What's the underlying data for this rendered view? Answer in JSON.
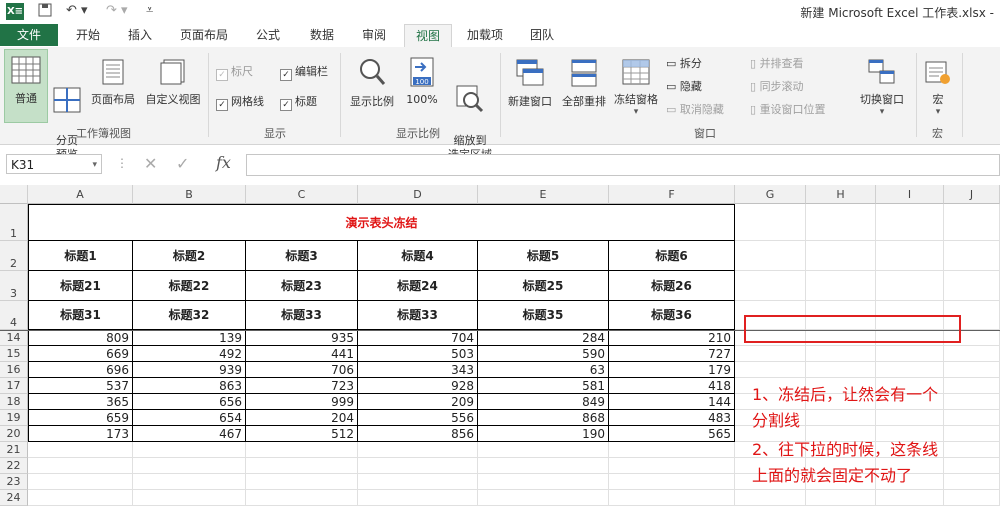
{
  "title_bar": {
    "app_logo": "X≡",
    "window_title": "新建 Microsoft Excel 工作表.xlsx -"
  },
  "tabs": [
    "文件",
    "开始",
    "插入",
    "页面布局",
    "公式",
    "数据",
    "审阅",
    "视图",
    "加载项",
    "团队"
  ],
  "active_tab": "视图",
  "ribbon": {
    "workbook_views": {
      "label": "工作簿视图",
      "normal": "普通",
      "page_break": "分页\n预览",
      "page_layout": "页面布局",
      "custom_view": "自定义视图"
    },
    "show": {
      "label": "显示",
      "ruler": "标尺",
      "formula_bar": "编辑栏",
      "gridlines": "网格线",
      "headings": "标题"
    },
    "zoom": {
      "label": "显示比例",
      "zoom": "显示比例",
      "zoom100": "100%",
      "zoom_selection": "缩放到\n选定区域",
      "icon_100": "100"
    },
    "window": {
      "label": "窗口",
      "new_window": "新建窗口",
      "arrange_all": "全部重排",
      "freeze_panes": "冻结窗格",
      "split": "拆分",
      "hide": "隐藏",
      "unhide": "取消隐藏",
      "side_by_side": "并排查看",
      "sync_scroll": "同步滚动",
      "reset_position": "重设窗口位置",
      "switch_windows": "切换窗口"
    },
    "macros": {
      "label": "宏",
      "macros": "宏"
    }
  },
  "formula_bar": {
    "name_box": "K31",
    "fx": "fx",
    "value": ""
  },
  "columns": [
    "A",
    "B",
    "C",
    "D",
    "E",
    "F",
    "G",
    "H",
    "I",
    "J"
  ],
  "rows": [
    "1",
    "2",
    "3",
    "4",
    "14",
    "15",
    "16",
    "17",
    "18",
    "19",
    "20",
    "21",
    "22",
    "23",
    "24"
  ],
  "sheet": {
    "title": "演示表头冻结",
    "header_rows": [
      [
        "标题1",
        "标题2",
        "标题3",
        "标题4",
        "标题5",
        "标题6"
      ],
      [
        "标题21",
        "标题22",
        "标题23",
        "标题24",
        "标题25",
        "标题26"
      ],
      [
        "标题31",
        "标题32",
        "标题33",
        "标题33",
        "标题35",
        "标题36"
      ]
    ],
    "data_rows": [
      [
        "809",
        "139",
        "935",
        "704",
        "284",
        "210"
      ],
      [
        "669",
        "492",
        "441",
        "503",
        "590",
        "727"
      ],
      [
        "696",
        "939",
        "706",
        "343",
        "63",
        "179"
      ],
      [
        "537",
        "863",
        "723",
        "928",
        "581",
        "418"
      ],
      [
        "365",
        "656",
        "999",
        "209",
        "849",
        "144"
      ],
      [
        "659",
        "654",
        "204",
        "556",
        "868",
        "483"
      ],
      [
        "173",
        "467",
        "512",
        "856",
        "190",
        "565"
      ]
    ]
  },
  "annotation": {
    "line1": "1、冻结后，让然会有一个",
    "line2": "分割线",
    "line3": "2、往下拉的时候，这条线",
    "line4": "上面的就会固定不动了"
  },
  "colors": {
    "excel_green": "#217346",
    "title_red": "#e01515",
    "annotation_red": "#e01515"
  }
}
